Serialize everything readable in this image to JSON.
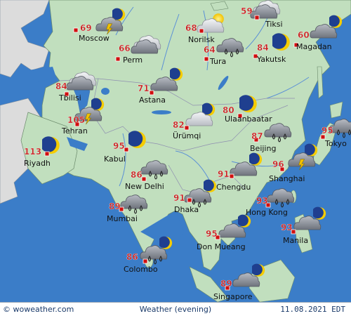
{
  "footer": {
    "copyright": "© woweather.com",
    "title": "Weather (evening)",
    "date": "11.08.2021 EDT"
  },
  "colors": {
    "ocean": "#3b7dc8",
    "land": "#c1dfbe",
    "land_outside": "#dcdcdc",
    "river": "#5a8fd6",
    "temperature": "#c81e1e",
    "city_marker": "#d01010",
    "label": "#111111"
  },
  "cities": [
    {
      "name": "Moscow",
      "temp": "69",
      "icon": "thunderstorm-rain-icon"
    },
    {
      "name": "Norilsk",
      "temp": "68",
      "icon": "partly-cloudy-sun-icon"
    },
    {
      "name": "Tiksi",
      "temp": "59",
      "icon": "overcast-icon"
    },
    {
      "name": "Magadan",
      "temp": "60",
      "icon": "cloudy-night-icon"
    },
    {
      "name": "Perm",
      "temp": "66",
      "icon": "overcast-icon"
    },
    {
      "name": "Tura",
      "temp": "64",
      "icon": "rain-icon"
    },
    {
      "name": "Yakutsk",
      "temp": "84",
      "icon": "moon-icon"
    },
    {
      "name": "Tbilisi",
      "temp": "84",
      "icon": "overcast-icon"
    },
    {
      "name": "Astana",
      "temp": "71",
      "icon": "cloudy-night-icon"
    },
    {
      "name": "Ulaanbaatar",
      "temp": "80",
      "icon": "moon-icon"
    },
    {
      "name": "Tehran",
      "temp": "105",
      "icon": "thunderstorm-rain-icon"
    },
    {
      "name": "Ürümqi",
      "temp": "82",
      "icon": "overcast-night-icon"
    },
    {
      "name": "Beijing",
      "temp": "87",
      "icon": "rain-icon"
    },
    {
      "name": "Tokyo",
      "temp": "95",
      "icon": "rain-icon"
    },
    {
      "name": "Riyadh",
      "temp": "113",
      "icon": "moon-icon"
    },
    {
      "name": "Kabul",
      "temp": "95",
      "icon": "moon-icon"
    },
    {
      "name": "Shanghai",
      "temp": "96",
      "icon": "thunderstorm-rain-icon"
    },
    {
      "name": "New Delhi",
      "temp": "86",
      "icon": "rain-icon"
    },
    {
      "name": "Chengdu",
      "temp": "91",
      "icon": "cloudy-night-icon"
    },
    {
      "name": "Dhaka",
      "temp": "91",
      "icon": "rain-night-icon"
    },
    {
      "name": "Mumbai",
      "temp": "89",
      "icon": "rain-icon"
    },
    {
      "name": "Hong Kong",
      "temp": "93",
      "icon": "rain-icon"
    },
    {
      "name": "Manila",
      "temp": "93",
      "icon": "cloudy-night-icon"
    },
    {
      "name": "Don Mueang",
      "temp": "95",
      "icon": "cloudy-night-icon"
    },
    {
      "name": "Colombo",
      "temp": "86",
      "icon": "rain-night-icon"
    },
    {
      "name": "Singapore",
      "temp": "89",
      "icon": "cloudy-night-icon"
    }
  ]
}
